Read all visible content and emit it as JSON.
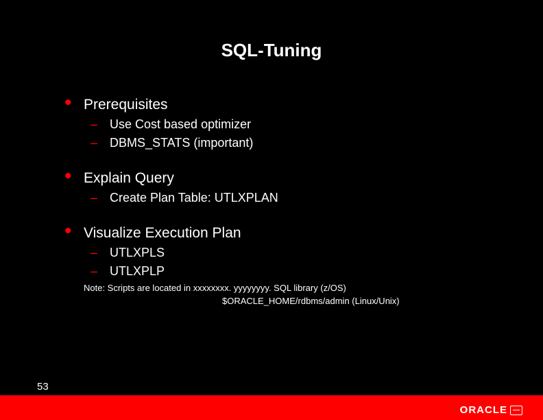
{
  "title": "SQL-Tuning",
  "bullets": {
    "b1": "Prerequisites",
    "b1s1": "Use Cost based optimizer",
    "b1s2": "DBMS_STATS  (important)",
    "b2": "Explain Query",
    "b2s1": "Create Plan Table: UTLXPLAN",
    "b3": "Visualize Execution Plan",
    "b3s1": "UTLXPLS",
    "b3s2": "UTLXPLP"
  },
  "note1": "Note:  Scripts are located  in  xxxxxxxx. yyyyyyyy. SQL library (z/OS)",
  "note2": "$ORACLE_HOME/rdbms/admin (Linux/Unix)",
  "page": "53",
  "logo": "ORACLE"
}
